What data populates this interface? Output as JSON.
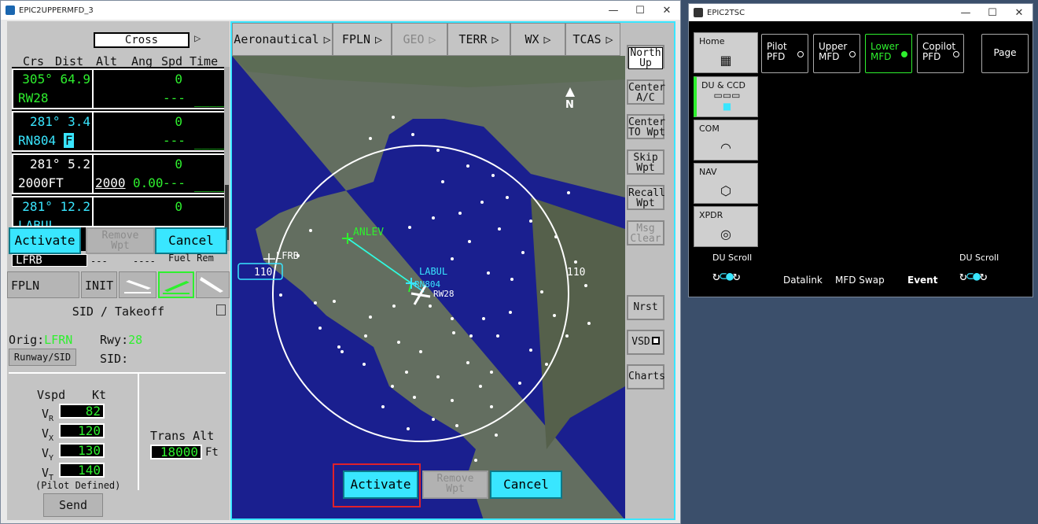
{
  "window1": {
    "title": "EPIC2UPPERMFD_3",
    "controls": [
      "—",
      "☐",
      "✕"
    ],
    "left": {
      "cross_label": "Cross",
      "headers": [
        "Crs",
        "Dist",
        "Alt",
        "Ang",
        "Spd",
        "Time"
      ],
      "waypoints": [
        {
          "crs_dist": "305° 64.9",
          "name": "RW28",
          "alt": "0",
          "dash": "---",
          "uline": "____",
          "color": "green"
        },
        {
          "crs_dist": "281° 3.4",
          "name": "RN804",
          "flag": "F",
          "alt": "0",
          "dash": "---",
          "uline": "____",
          "color": "cyan"
        },
        {
          "crs_dist": "281° 5.2",
          "name": "2000FT",
          "alt_con": "2000",
          "ang": "0.00",
          "alt": "0",
          "dash": "---",
          "uline": "____",
          "color": "white"
        },
        {
          "crs_dist": "281° 12.2",
          "name": "LABUL",
          "alt": "0",
          "color": "cyan"
        }
      ],
      "activate": "Activate",
      "remove": "Remove\nWpt",
      "cancel": "Cancel",
      "origin_field": "LFRB",
      "dashes1": "---",
      "dashes2": "----",
      "fuel_rem": "Fuel Rem",
      "tabs": {
        "fplan": "FPLN",
        "init": "INIT"
      },
      "sid_title": "SID / Takeoff",
      "orig_label": "Orig:",
      "orig_value": "LFRN",
      "rwy_label": "Rwy:",
      "rwy_value": "28",
      "runway_sid_btn": "Runway/SID",
      "sid_label": "SID:",
      "vspd_header": "Vspd",
      "kt_header": "Kt",
      "vspeeds": [
        {
          "label": "V",
          "sub": "R",
          "value": "82"
        },
        {
          "label": "V",
          "sub": "X",
          "value": "120"
        },
        {
          "label": "V",
          "sub": "Y",
          "value": "130"
        },
        {
          "label": "V",
          "sub": "T",
          "value": "140"
        }
      ],
      "pilot_defined": "(Pilot Defined)",
      "send": "Send",
      "trans_alt_label": "Trans Alt",
      "trans_alt_value": "18000",
      "trans_alt_unit": "Ft"
    },
    "map": {
      "toolbar": [
        {
          "label": "Aeronautical",
          "enabled": true
        },
        {
          "label": "FPLN",
          "enabled": true
        },
        {
          "label": "GEO",
          "enabled": false
        },
        {
          "label": "TERR",
          "enabled": true
        },
        {
          "label": "WX",
          "enabled": true
        },
        {
          "label": "TCAS",
          "enabled": true
        }
      ],
      "arrow": "▷",
      "side_buttons": [
        {
          "label": "North\nUp",
          "enabled": true
        },
        {
          "label": "Center\nA/C",
          "enabled": true
        },
        {
          "label": "Center\nTO Wpt",
          "enabled": true
        },
        {
          "label": "Skip\nWpt",
          "enabled": true
        },
        {
          "label": "Recall\nWpt",
          "enabled": true
        },
        {
          "label": "Msg\nClear",
          "enabled": false
        },
        {
          "label": "Nrst",
          "enabled": true
        },
        {
          "label": "VSD",
          "enabled": true
        },
        {
          "label": "Charts",
          "enabled": true
        }
      ],
      "north": "N",
      "range_left": "110",
      "range_right": "110",
      "labels": {
        "anlev": "ANLEV",
        "labul": "LABUL",
        "lfrb": "LFRB",
        "rn804": "RN804",
        "rw28": "RW28"
      },
      "activate": "Activate",
      "remove": "Remove\nWpt",
      "cancel": "Cancel"
    }
  },
  "window2": {
    "title": "EPIC2TSC",
    "controls": [
      "—",
      "☐",
      "✕"
    ],
    "side": [
      {
        "label": "Home",
        "icon": "grid-icon"
      },
      {
        "label": "DU & CCD",
        "icon": "display-icon"
      },
      {
        "label": "COM",
        "icon": "headset-icon"
      },
      {
        "label": "NAV",
        "icon": "nav-icon"
      },
      {
        "label": "XPDR",
        "icon": "xpdr-icon"
      }
    ],
    "tabs": [
      {
        "label": "Pilot\nPFD",
        "active": false
      },
      {
        "label": "Upper\nMFD",
        "active": false
      },
      {
        "label": "Lower\nMFD",
        "active": true
      },
      {
        "label": "Copilot\nPFD",
        "active": false
      }
    ],
    "page_btn": "Page",
    "du_scroll_left": "DU Scroll",
    "du_scroll_right": "DU Scroll",
    "datalink": "Datalink",
    "mfd_swap": "MFD Swap",
    "event": "Event"
  }
}
